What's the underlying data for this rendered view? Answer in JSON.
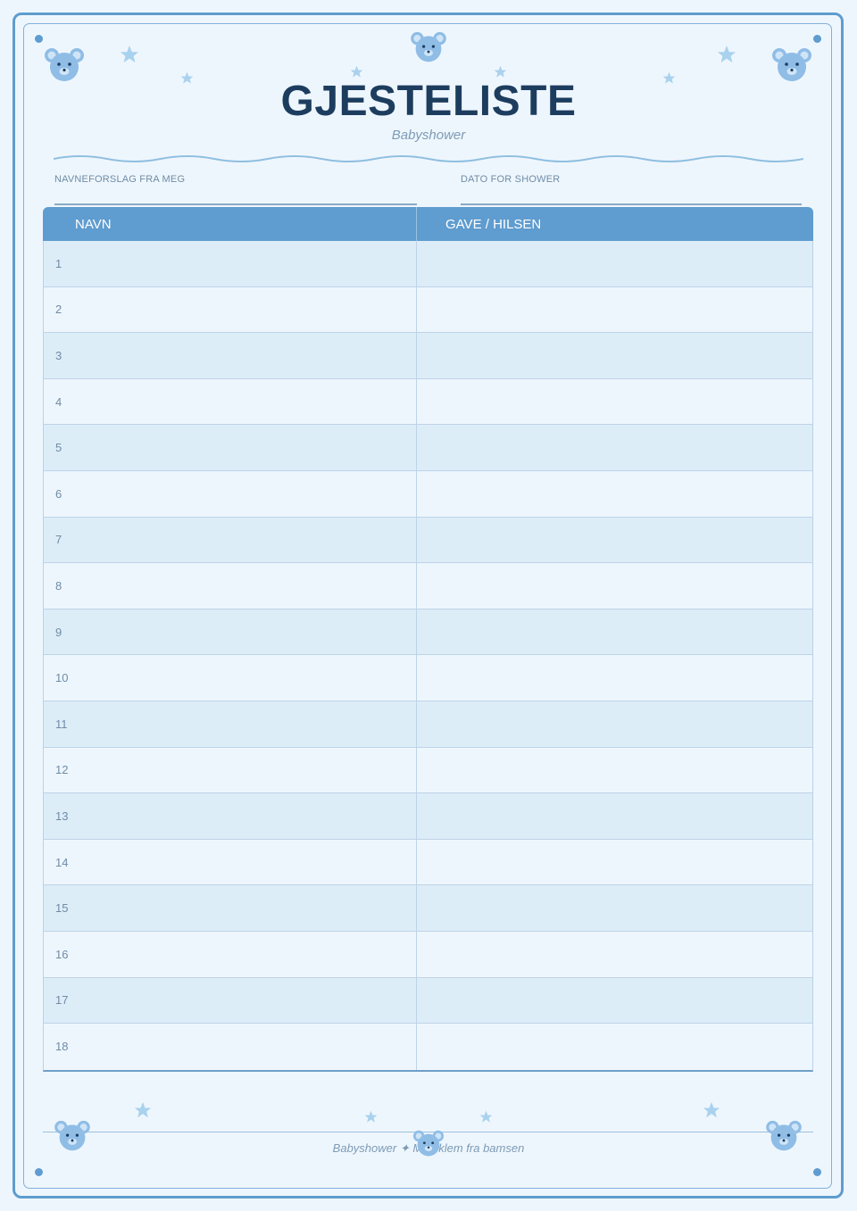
{
  "header": {
    "title": "GJESTELISTE",
    "subtitle": "Babyshower"
  },
  "fields": {
    "name_suggestion_label": "NAVNEFORSLAG FRA MEG",
    "shower_date_label": "DATO FOR SHOWER"
  },
  "table": {
    "columns": [
      "NAVN",
      "GAVE / HILSEN"
    ],
    "rows": [
      "1",
      "2",
      "3",
      "4",
      "5",
      "6",
      "7",
      "8",
      "9",
      "10",
      "11",
      "12",
      "13",
      "14",
      "15",
      "16",
      "17",
      "18"
    ]
  },
  "footer": {
    "text": "Babyshower ✦ Med klem fra bamsen"
  },
  "icons": {
    "bear": "bear-face-icon",
    "star": "star-icon"
  },
  "colors": {
    "accent": "#5f9ccf",
    "title": "#1d3d5f",
    "background": "#eef6fd",
    "row_alt": "#ddedf8",
    "star": "#a9d2ee",
    "bear": "#8fbde6"
  }
}
